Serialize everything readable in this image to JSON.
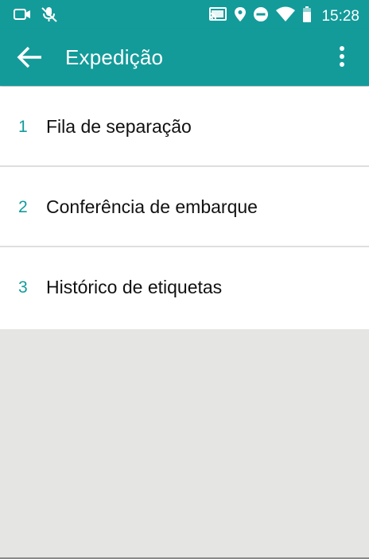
{
  "status_bar": {
    "time": "15:28",
    "icons": [
      "video-camera-icon",
      "mic-off-icon",
      "cast-icon",
      "location-icon",
      "do-not-disturb-icon",
      "wifi-icon",
      "battery-icon"
    ]
  },
  "app_bar": {
    "title": "Expedição",
    "back_icon": "arrow-left-icon",
    "menu_icon": "more-vert-icon"
  },
  "menu": [
    {
      "number": "1",
      "label": "Fila de separação"
    },
    {
      "number": "2",
      "label": "Conferência de embarque"
    },
    {
      "number": "3",
      "label": "Histórico de etiquetas"
    }
  ],
  "colors": {
    "primary": "#139b9a",
    "background": "#e5e5e3",
    "item_background": "#ffffff",
    "number_color": "#139b9a"
  }
}
